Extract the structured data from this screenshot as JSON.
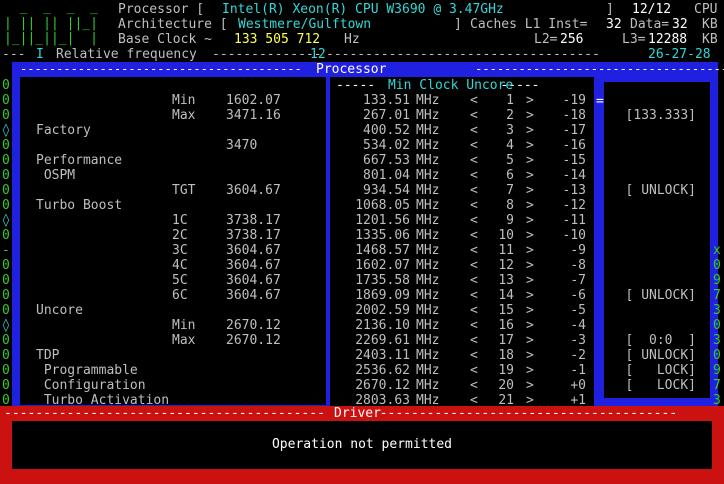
{
  "header": {
    "processor_label": "Processor [",
    "processor_value": "Intel(R) Xeon(R) CPU W3690 @ 3.47GHz",
    "processor_close": "]",
    "cpu_count": "12/12",
    "cpu_label": "CPU",
    "arch_label": "Architecture [",
    "arch_value": "Westmere/Gulftown",
    "arch_close": "]",
    "caches_label": "Caches L1 Inst=",
    "l1i": "32",
    "data_label": "Data=",
    "l1d": "32",
    "kb1": "KB",
    "base_label": "Base Clock ~",
    "base_value": "133 505 712",
    "hz": "Hz",
    "l2_label": "L2=",
    "l2": "256",
    "l3_label": "L3=",
    "l3": "12288",
    "kb2": "KB",
    "freq_label": "Relative frequency",
    "freq_marker": "I",
    "scale_12": "12",
    "scale_right": "26-27-28"
  },
  "processor_panel": {
    "title": "Processor",
    "rows": [
      {
        "label": "",
        "sub": "Min",
        "value": "1602.07"
      },
      {
        "label": "",
        "sub": "Max",
        "value": "3471.16"
      },
      {
        "label": "Factory",
        "sub": "",
        "value": ""
      },
      {
        "label": "",
        "sub": "",
        "value": "3470"
      },
      {
        "label": "Performance",
        "sub": "",
        "value": ""
      },
      {
        "label": " OSPM",
        "sub": "",
        "value": ""
      },
      {
        "label": "",
        "sub": "TGT",
        "value": "3604.67"
      },
      {
        "label": "Turbo Boost",
        "sub": "",
        "value": ""
      },
      {
        "label": "",
        "sub": "1C",
        "value": "3738.17"
      },
      {
        "label": "",
        "sub": "2C",
        "value": "3738.17"
      },
      {
        "label": "",
        "sub": "3C",
        "value": "3604.67"
      },
      {
        "label": "",
        "sub": "4C",
        "value": "3604.67"
      },
      {
        "label": "",
        "sub": "5C",
        "value": "3604.67"
      },
      {
        "label": "",
        "sub": "6C",
        "value": "3604.67"
      },
      {
        "label": "Uncore",
        "sub": "",
        "value": ""
      },
      {
        "label": "",
        "sub": "Min",
        "value": "2670.12"
      },
      {
        "label": "",
        "sub": "Max",
        "value": "2670.12"
      },
      {
        "label": "TDP",
        "sub": "",
        "value": ""
      },
      {
        "label": " Programmable",
        "sub": "",
        "value": ""
      },
      {
        "label": " Configuration",
        "sub": "",
        "value": ""
      },
      {
        "label": " Turbo Activation",
        "sub": "",
        "value": ""
      }
    ]
  },
  "clock_panel": {
    "title": "Min Clock Uncore",
    "unit": "MHz",
    "rows": [
      {
        "freq": "133.51",
        "idx": "1",
        "off": "-19"
      },
      {
        "freq": "267.01",
        "idx": "2",
        "off": "-18"
      },
      {
        "freq": "400.52",
        "idx": "3",
        "off": "-17"
      },
      {
        "freq": "534.02",
        "idx": "4",
        "off": "-16"
      },
      {
        "freq": "667.53",
        "idx": "5",
        "off": "-15"
      },
      {
        "freq": "801.04",
        "idx": "6",
        "off": "-14"
      },
      {
        "freq": "934.54",
        "idx": "7",
        "off": "-13"
      },
      {
        "freq": "1068.05",
        "idx": "8",
        "off": "-12"
      },
      {
        "freq": "1201.56",
        "idx": "9",
        "off": "-11"
      },
      {
        "freq": "1335.06",
        "idx": "10",
        "off": "-10"
      },
      {
        "freq": "1468.57",
        "idx": "11",
        "off": "-9"
      },
      {
        "freq": "1602.07",
        "idx": "12",
        "off": "-8"
      },
      {
        "freq": "1735.58",
        "idx": "13",
        "off": "-7"
      },
      {
        "freq": "1869.09",
        "idx": "14",
        "off": "-6"
      },
      {
        "freq": "2002.59",
        "idx": "15",
        "off": "-5"
      },
      {
        "freq": "2136.10",
        "idx": "16",
        "off": "-4"
      },
      {
        "freq": "2269.61",
        "idx": "17",
        "off": "-3"
      },
      {
        "freq": "2403.11",
        "idx": "18",
        "off": "-2"
      },
      {
        "freq": "2536.62",
        "idx": "19",
        "off": "-1"
      },
      {
        "freq": "2670.12",
        "idx": "20",
        "off": "+0"
      },
      {
        "freq": "2803.63",
        "idx": "21",
        "off": "+1"
      }
    ]
  },
  "right_panel": {
    "rows": [
      "",
      "[133.333]",
      "",
      "",
      "",
      "",
      "[ UNLOCK]",
      "",
      "",
      "",
      "",
      "",
      "",
      "[ UNLOCK]",
      "",
      "",
      "[  0:0  ]",
      "[ UNLOCK]",
      "[   LOCK]",
      "[   LOCK]",
      ""
    ]
  },
  "left_edge": [
    "0",
    "0",
    "0",
    "◊",
    "0",
    "0",
    "0",
    "0",
    "0",
    "◊",
    "0",
    "-",
    "0",
    "0",
    "0",
    "0",
    "◊",
    "0",
    "0",
    "0",
    "0",
    "0"
  ],
  "right_edge": [
    "",
    "",
    "",
    "",
    "",
    "",
    "",
    "",
    "",
    "",
    "",
    "x",
    "0",
    "9",
    "7",
    "3",
    "0",
    "3",
    "0",
    "9",
    "7",
    "3"
  ],
  "driver": {
    "title": "Driver",
    "message": "Operation not permitted"
  }
}
